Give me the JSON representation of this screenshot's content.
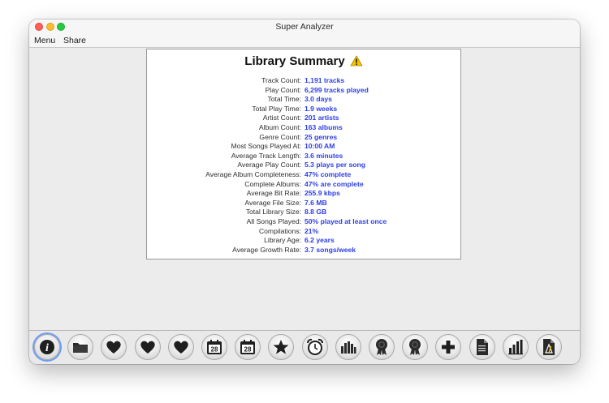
{
  "window": {
    "title": "Super Analyzer"
  },
  "menubar": {
    "items": [
      "Menu",
      "Share"
    ]
  },
  "summary": {
    "title": "Library Summary",
    "warning_icon": "warning-icon",
    "rows": [
      {
        "label": "Track Count:",
        "value": "1,191 tracks"
      },
      {
        "label": "Play Count:",
        "value": "6,299 tracks played"
      },
      {
        "label": "Total Time:",
        "value": "3.0 days"
      },
      {
        "label": "Total Play Time:",
        "value": "1.9 weeks"
      },
      {
        "label": "Artist Count:",
        "value": "201 artists"
      },
      {
        "label": "Album Count:",
        "value": "163 albums"
      },
      {
        "label": "Genre Count:",
        "value": "25 genres"
      },
      {
        "label": "Most Songs Played At:",
        "value": "10:00 AM"
      },
      {
        "label": "Average Track Length:",
        "value": "3.6 minutes"
      },
      {
        "label": "Average Play Count:",
        "value": "5.3 plays per song"
      },
      {
        "label": "Average Album Completeness:",
        "value": "47% complete"
      },
      {
        "label": "Complete Albums:",
        "value": "47% are complete"
      },
      {
        "label": "Average Bit Rate:",
        "value": "255.9 kbps"
      },
      {
        "label": "Average File Size:",
        "value": "7.6 MB"
      },
      {
        "label": "Total Library Size:",
        "value": "8.8 GB"
      },
      {
        "label": "All Songs Played:",
        "value": "50% played at least once"
      },
      {
        "label": "Compilations:",
        "value": "21%"
      },
      {
        "label": "Library Age:",
        "value": "6.2 years"
      },
      {
        "label": "Average Growth Rate:",
        "value": "3.7 songs/week"
      }
    ]
  },
  "toolbar": {
    "buttons": [
      {
        "icon": "info-icon",
        "selected": true
      },
      {
        "icon": "folder-icon"
      },
      {
        "icon": "heart-icon"
      },
      {
        "icon": "heart-icon"
      },
      {
        "icon": "heart-icon"
      },
      {
        "icon": "calendar-icon",
        "text": "28"
      },
      {
        "icon": "calendar-icon",
        "text": "28"
      },
      {
        "icon": "star-icon"
      },
      {
        "icon": "alarm-clock-icon"
      },
      {
        "icon": "equalizer-icon"
      },
      {
        "icon": "award-ribbon-icon"
      },
      {
        "icon": "award-ribbon-icon"
      },
      {
        "icon": "plus-icon"
      },
      {
        "icon": "document-icon"
      },
      {
        "icon": "bar-chart-icon"
      },
      {
        "icon": "tuner-doc-icon"
      }
    ]
  },
  "colors": {
    "value_text": "#2d3ee8",
    "selected_ring": "#6c9ef4",
    "warning": "#f5c400"
  }
}
